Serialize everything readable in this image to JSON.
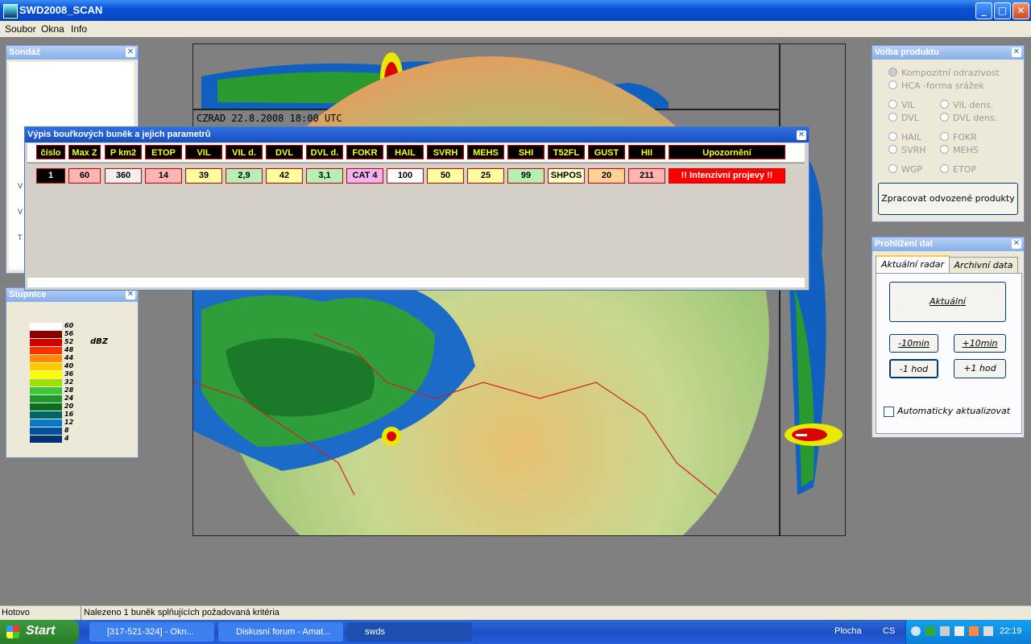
{
  "window": {
    "title": "SWD2008_SCAN",
    "buttons": [
      "_",
      "□",
      "✕"
    ]
  },
  "menu": [
    "Soubor",
    "Okna",
    "Info"
  ],
  "sondaz": {
    "title": "Sondáž",
    "side_letters": [
      "V",
      "V",
      "T"
    ]
  },
  "stupnice": {
    "title": "Stupnice",
    "unit": "dBZ",
    "levels": [
      {
        "label": "60",
        "color": "#ffffff"
      },
      {
        "label": "56",
        "color": "#8b0000"
      },
      {
        "label": "52",
        "color": "#d40000"
      },
      {
        "label": "48",
        "color": "#ff3000"
      },
      {
        "label": "44",
        "color": "#ff8c00"
      },
      {
        "label": "40",
        "color": "#ffc800"
      },
      {
        "label": "36",
        "color": "#ffff00"
      },
      {
        "label": "32",
        "color": "#a0e000"
      },
      {
        "label": "28",
        "color": "#3cc83c"
      },
      {
        "label": "24",
        "color": "#1e9628"
      },
      {
        "label": "20",
        "color": "#0a6e1e"
      },
      {
        "label": "16",
        "color": "#006464"
      },
      {
        "label": "12",
        "color": "#0a78c8"
      },
      {
        "label": "8",
        "color": "#0050a0"
      },
      {
        "label": "4",
        "color": "#003278"
      }
    ]
  },
  "radar": {
    "caption": "CZRAD   22.8.2008    18:00 UTC"
  },
  "cells_table": {
    "title": "Výpis bouřkových buněk a jejich parametrů",
    "headers": [
      "číslo",
      "Max Z",
      "P km2",
      "ETOP",
      "VIL",
      "VIL d.",
      "DVL",
      "DVL d.",
      "FOKR",
      "HAIL",
      "SVRH",
      "MEHS",
      "SHI",
      "T52FL",
      "GUST",
      "HII",
      "Upozornění"
    ],
    "row": [
      {
        "v": "1",
        "bg": "#000000",
        "fg": "#ffffff"
      },
      {
        "v": "60",
        "bg": "#ffb4b4",
        "fg": "#000000"
      },
      {
        "v": "360",
        "bg": "#f0f0f0",
        "fg": "#000000"
      },
      {
        "v": "14",
        "bg": "#ffb4b4",
        "fg": "#000000"
      },
      {
        "v": "39",
        "bg": "#ffffa0",
        "fg": "#000000"
      },
      {
        "v": "2,9",
        "bg": "#b4f0b4",
        "fg": "#000000"
      },
      {
        "v": "42",
        "bg": "#ffffa0",
        "fg": "#000000"
      },
      {
        "v": "3,1",
        "bg": "#b4f0b4",
        "fg": "#000000"
      },
      {
        "v": "CAT 4",
        "bg": "#f0b4f0",
        "fg": "#000000"
      },
      {
        "v": "100",
        "bg": "#ffffff",
        "fg": "#000000"
      },
      {
        "v": "50",
        "bg": "#ffffa0",
        "fg": "#000000"
      },
      {
        "v": "25",
        "bg": "#ffffa0",
        "fg": "#000000"
      },
      {
        "v": "99",
        "bg": "#b4f0b4",
        "fg": "#000000"
      },
      {
        "v": "SHPOS",
        "bg": "#ffffc8",
        "fg": "#000000"
      },
      {
        "v": "20",
        "bg": "#ffd296",
        "fg": "#000000"
      },
      {
        "v": "211",
        "bg": "#ffb4b4",
        "fg": "#000000"
      },
      {
        "v": "!! Intenzivní projevy !!",
        "bg": "#ff0000",
        "fg": "#ffffff"
      }
    ]
  },
  "volba": {
    "title": "Volba produktu",
    "options": [
      "Kompozitní odrazivost",
      "HCA -forma srážek",
      "VIL",
      "VIL dens.",
      "DVL",
      "DVL dens.",
      "HAIL",
      "FOKR",
      "SVRH",
      "MEHS",
      "WGP",
      "ETOP"
    ],
    "button": "Zpracovat odvozené produkty"
  },
  "prohlizeni": {
    "title": "Prohlížení dat",
    "tabs": [
      "Aktuální radar",
      "Archivní data"
    ],
    "current_btn": "Aktuální",
    "buttons": [
      "-10min",
      "+10min",
      "-1 hod",
      "+1 hod"
    ],
    "auto_label": "Automaticky aktualizovat",
    "auto_checked": false
  },
  "status": {
    "left": "Hotovo",
    "right": "Nalezeno 1 buněk splňujících požadovaná kritéria"
  },
  "taskbar": {
    "start": "Start",
    "tasks": [
      "[317-521-324] - Okn...",
      "Diskusní forum - Amat...",
      "swds"
    ],
    "plocha": "Plocha",
    "lang": "CS",
    "clock": "22:19"
  }
}
